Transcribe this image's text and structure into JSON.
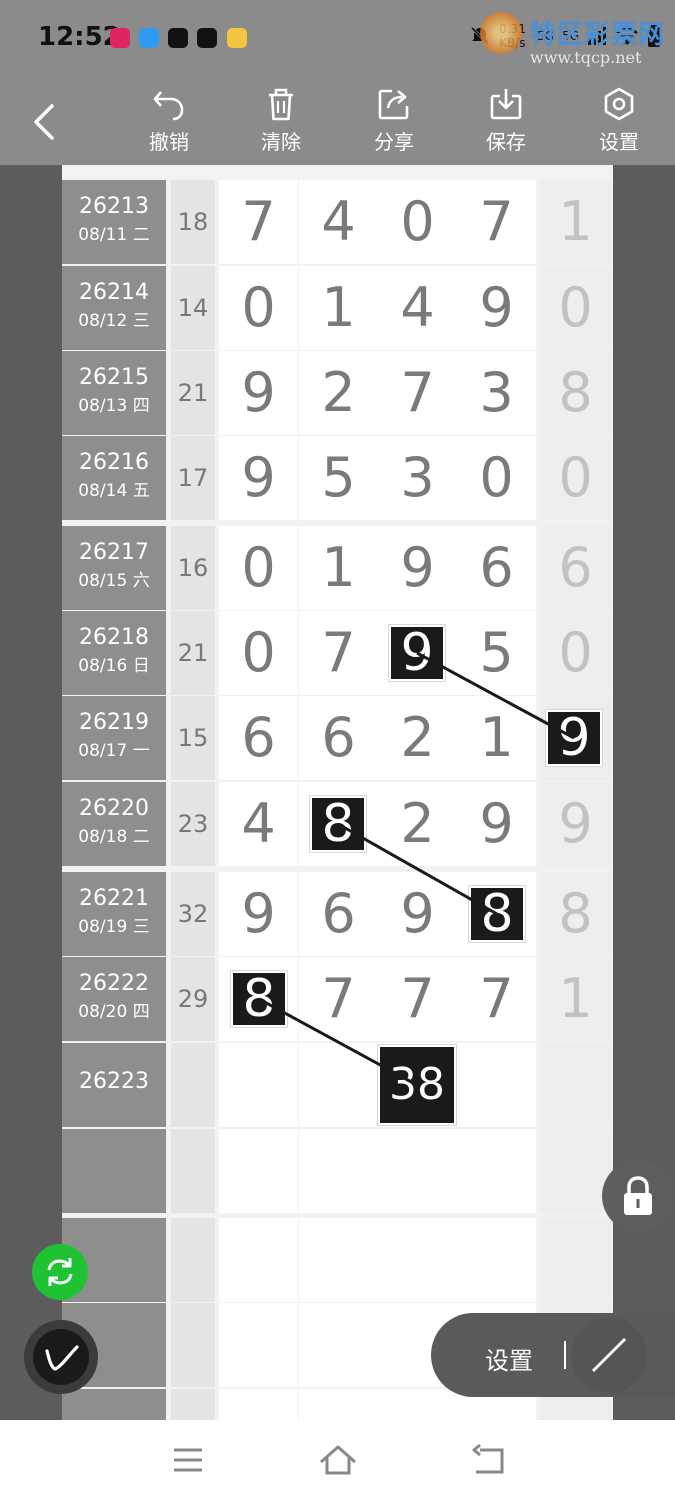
{
  "status_bar": {
    "time": "12:52",
    "net_speed_value": "0.31",
    "net_speed_unit": "KB/s",
    "network_a": "5G",
    "network_b": "5G",
    "app_icons": [
      "music-app-icon",
      "chat-app-icon",
      "tiktok-icon",
      "tiktok-icon",
      "assistant-app-icon"
    ],
    "status_icons": [
      "mute-bell-icon",
      "signal-icon",
      "wifi-icon",
      "battery-icon"
    ]
  },
  "watermark": {
    "title": "特区彩票网",
    "url": "www.tqcp.net"
  },
  "toolbar": {
    "back_icon": "chevron-left-icon",
    "items": [
      {
        "label": "撤销",
        "icon": "undo-icon"
      },
      {
        "label": "清除",
        "icon": "trash-icon"
      },
      {
        "label": "分享",
        "icon": "share-icon"
      },
      {
        "label": "保存",
        "icon": "download-icon"
      },
      {
        "label": "设置",
        "icon": "hexagon-settings-icon"
      }
    ]
  },
  "table": {
    "rows": [
      {
        "issue": "26213",
        "date": "08/11 二",
        "sum": "18",
        "digits": [
          "7",
          "4",
          "0",
          "7"
        ],
        "extra": "1"
      },
      {
        "issue": "26214",
        "date": "08/12 三",
        "sum": "14",
        "digits": [
          "0",
          "1",
          "4",
          "9"
        ],
        "extra": "0"
      },
      {
        "issue": "26215",
        "date": "08/13 四",
        "sum": "21",
        "digits": [
          "9",
          "2",
          "7",
          "3"
        ],
        "extra": "8"
      },
      {
        "issue": "26216",
        "date": "08/14 五",
        "sum": "17",
        "digits": [
          "9",
          "5",
          "3",
          "0"
        ],
        "extra": "0"
      },
      {
        "issue": "26217",
        "date": "08/15 六",
        "sum": "16",
        "digits": [
          "0",
          "1",
          "9",
          "6"
        ],
        "extra": "6"
      },
      {
        "issue": "26218",
        "date": "08/16 日",
        "sum": "21",
        "digits": [
          "0",
          "7",
          "9",
          "5"
        ],
        "extra": "0"
      },
      {
        "issue": "26219",
        "date": "08/17 一",
        "sum": "15",
        "digits": [
          "6",
          "6",
          "2",
          "1"
        ],
        "extra": "9"
      },
      {
        "issue": "26220",
        "date": "08/18 二",
        "sum": "23",
        "digits": [
          "4",
          "8",
          "2",
          "9"
        ],
        "extra": "9"
      },
      {
        "issue": "26221",
        "date": "08/19 三",
        "sum": "32",
        "digits": [
          "9",
          "6",
          "9",
          "8"
        ],
        "extra": "8"
      },
      {
        "issue": "26222",
        "date": "08/20 四",
        "sum": "29",
        "digits": [
          "8",
          "7",
          "7",
          "7"
        ],
        "extra": "1"
      },
      {
        "issue": "26223",
        "date": "",
        "sum": "",
        "digits": [
          "",
          "",
          "",
          ""
        ],
        "extra": ""
      },
      {
        "issue": "",
        "date": "",
        "sum": "",
        "digits": [
          "",
          "",
          "",
          ""
        ],
        "extra": ""
      },
      {
        "issue": "",
        "date": "",
        "sum": "",
        "digits": [
          "",
          "",
          "",
          ""
        ],
        "extra": ""
      },
      {
        "issue": "",
        "date": "",
        "sum": "",
        "digits": [
          "",
          "",
          "",
          ""
        ],
        "extra": ""
      },
      {
        "issue": "",
        "date": "",
        "sum": "",
        "digits": [
          "",
          "",
          "",
          ""
        ],
        "extra": ""
      }
    ],
    "marks": [
      {
        "row": 5,
        "col": 2,
        "value": "9"
      },
      {
        "row": 6,
        "col": 4,
        "value": "9"
      },
      {
        "row": 7,
        "col": 1,
        "value": "8"
      },
      {
        "row": 8,
        "col": 3,
        "value": "8"
      },
      {
        "row": 9,
        "col": 0,
        "value": "8"
      },
      {
        "row": 10,
        "col": 2,
        "value": "38"
      }
    ],
    "links": [
      [
        0,
        1
      ],
      [
        2,
        3
      ],
      [
        4,
        5
      ]
    ]
  },
  "controls": {
    "lock_icon": "lock-icon",
    "refresh_icon": "refresh-icon",
    "pen_icon": "pen-icon",
    "settings_label": "设置",
    "line_tool_icon": "line-tool-icon"
  },
  "nav_bar": {
    "buttons": [
      "menu-icon",
      "home-icon",
      "back-icon"
    ]
  }
}
